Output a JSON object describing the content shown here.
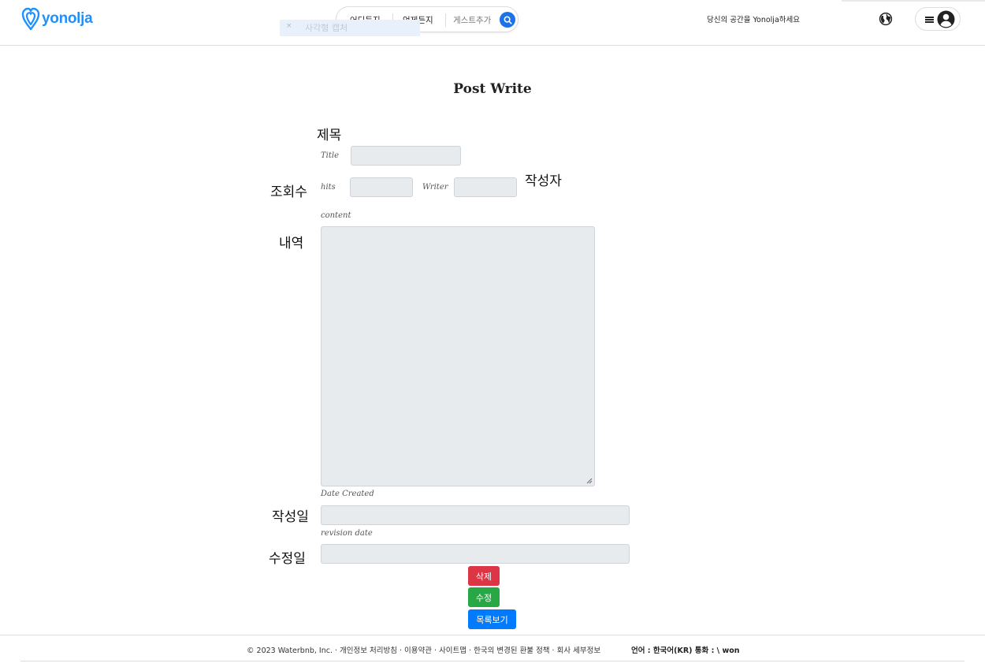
{
  "header": {
    "brand": "yonolja",
    "search": {
      "where_label": "어디든지",
      "when_label": "언제든지",
      "guest_placeholder": "게스트추가"
    },
    "ghost_tab": {
      "close": "×",
      "label": "사각형 캡처"
    },
    "tagline": "당신의 공간을 Yonolja하세요",
    "accent_color": "#1a73e8",
    "icons": [
      "yonolja-logo-icon",
      "search-icon",
      "globe-icon",
      "hamburger-icon",
      "user-avatar-icon"
    ]
  },
  "form": {
    "title": "Post Write",
    "fields": {
      "title": {
        "label_ko": "제목",
        "label_en": "Title",
        "value": ""
      },
      "hits": {
        "label_ko": "조회수",
        "label_en": "hits",
        "value": ""
      },
      "writer": {
        "label_ko": "작성자",
        "label_en": "Writer",
        "value": ""
      },
      "content": {
        "label_ko": "내역",
        "label_en": "content",
        "value": ""
      },
      "created": {
        "label_ko": "작성일",
        "label_en": "Date Created",
        "value": ""
      },
      "revised": {
        "label_ko": "수정일",
        "label_en": "revision date",
        "value": ""
      }
    },
    "buttons": {
      "delete": "삭제",
      "edit": "수정",
      "list": "목록보기"
    },
    "button_colors": {
      "delete": "#dc3545",
      "edit": "#28a745",
      "list": "#007bff"
    }
  },
  "footer": {
    "links": "© 2023 Waterbnb, Inc. · 개인정보 처리방침 · 이용약관 · 사이트맵 · 한국의 변경된 환불 정책 · 회사 세부정보",
    "lang_currency": "언어 : 한국어(KR) 통화 : \\ won"
  }
}
